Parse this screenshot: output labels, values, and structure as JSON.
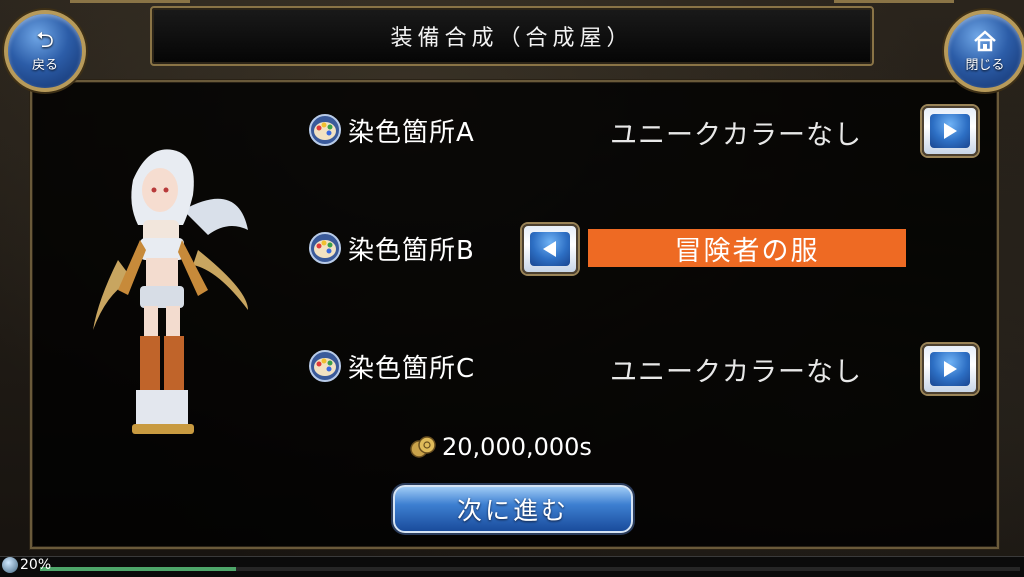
{
  "header": {
    "title": "装備合成（合成屋）",
    "back_label": "戻る",
    "close_label": "閉じる"
  },
  "rows": [
    {
      "label": "染色箇所A",
      "value": "ユニークカラーなし"
    },
    {
      "label": "染色箇所B",
      "value": "冒険者の服"
    },
    {
      "label": "染色箇所C",
      "value": "ユニークカラーなし"
    }
  ],
  "price": "20,000,000s",
  "next_button": "次に進む",
  "status": {
    "percent": "20%",
    "progress": 0.2
  },
  "colors": {
    "accent": "#ee6a23",
    "button_blue": "#2d6fc4",
    "frame_gold": "#8a7446"
  },
  "icons": [
    "back-arrow-icon",
    "home-icon",
    "palette-icon",
    "arrow-right-icon",
    "arrow-left-icon",
    "coin-icon"
  ]
}
